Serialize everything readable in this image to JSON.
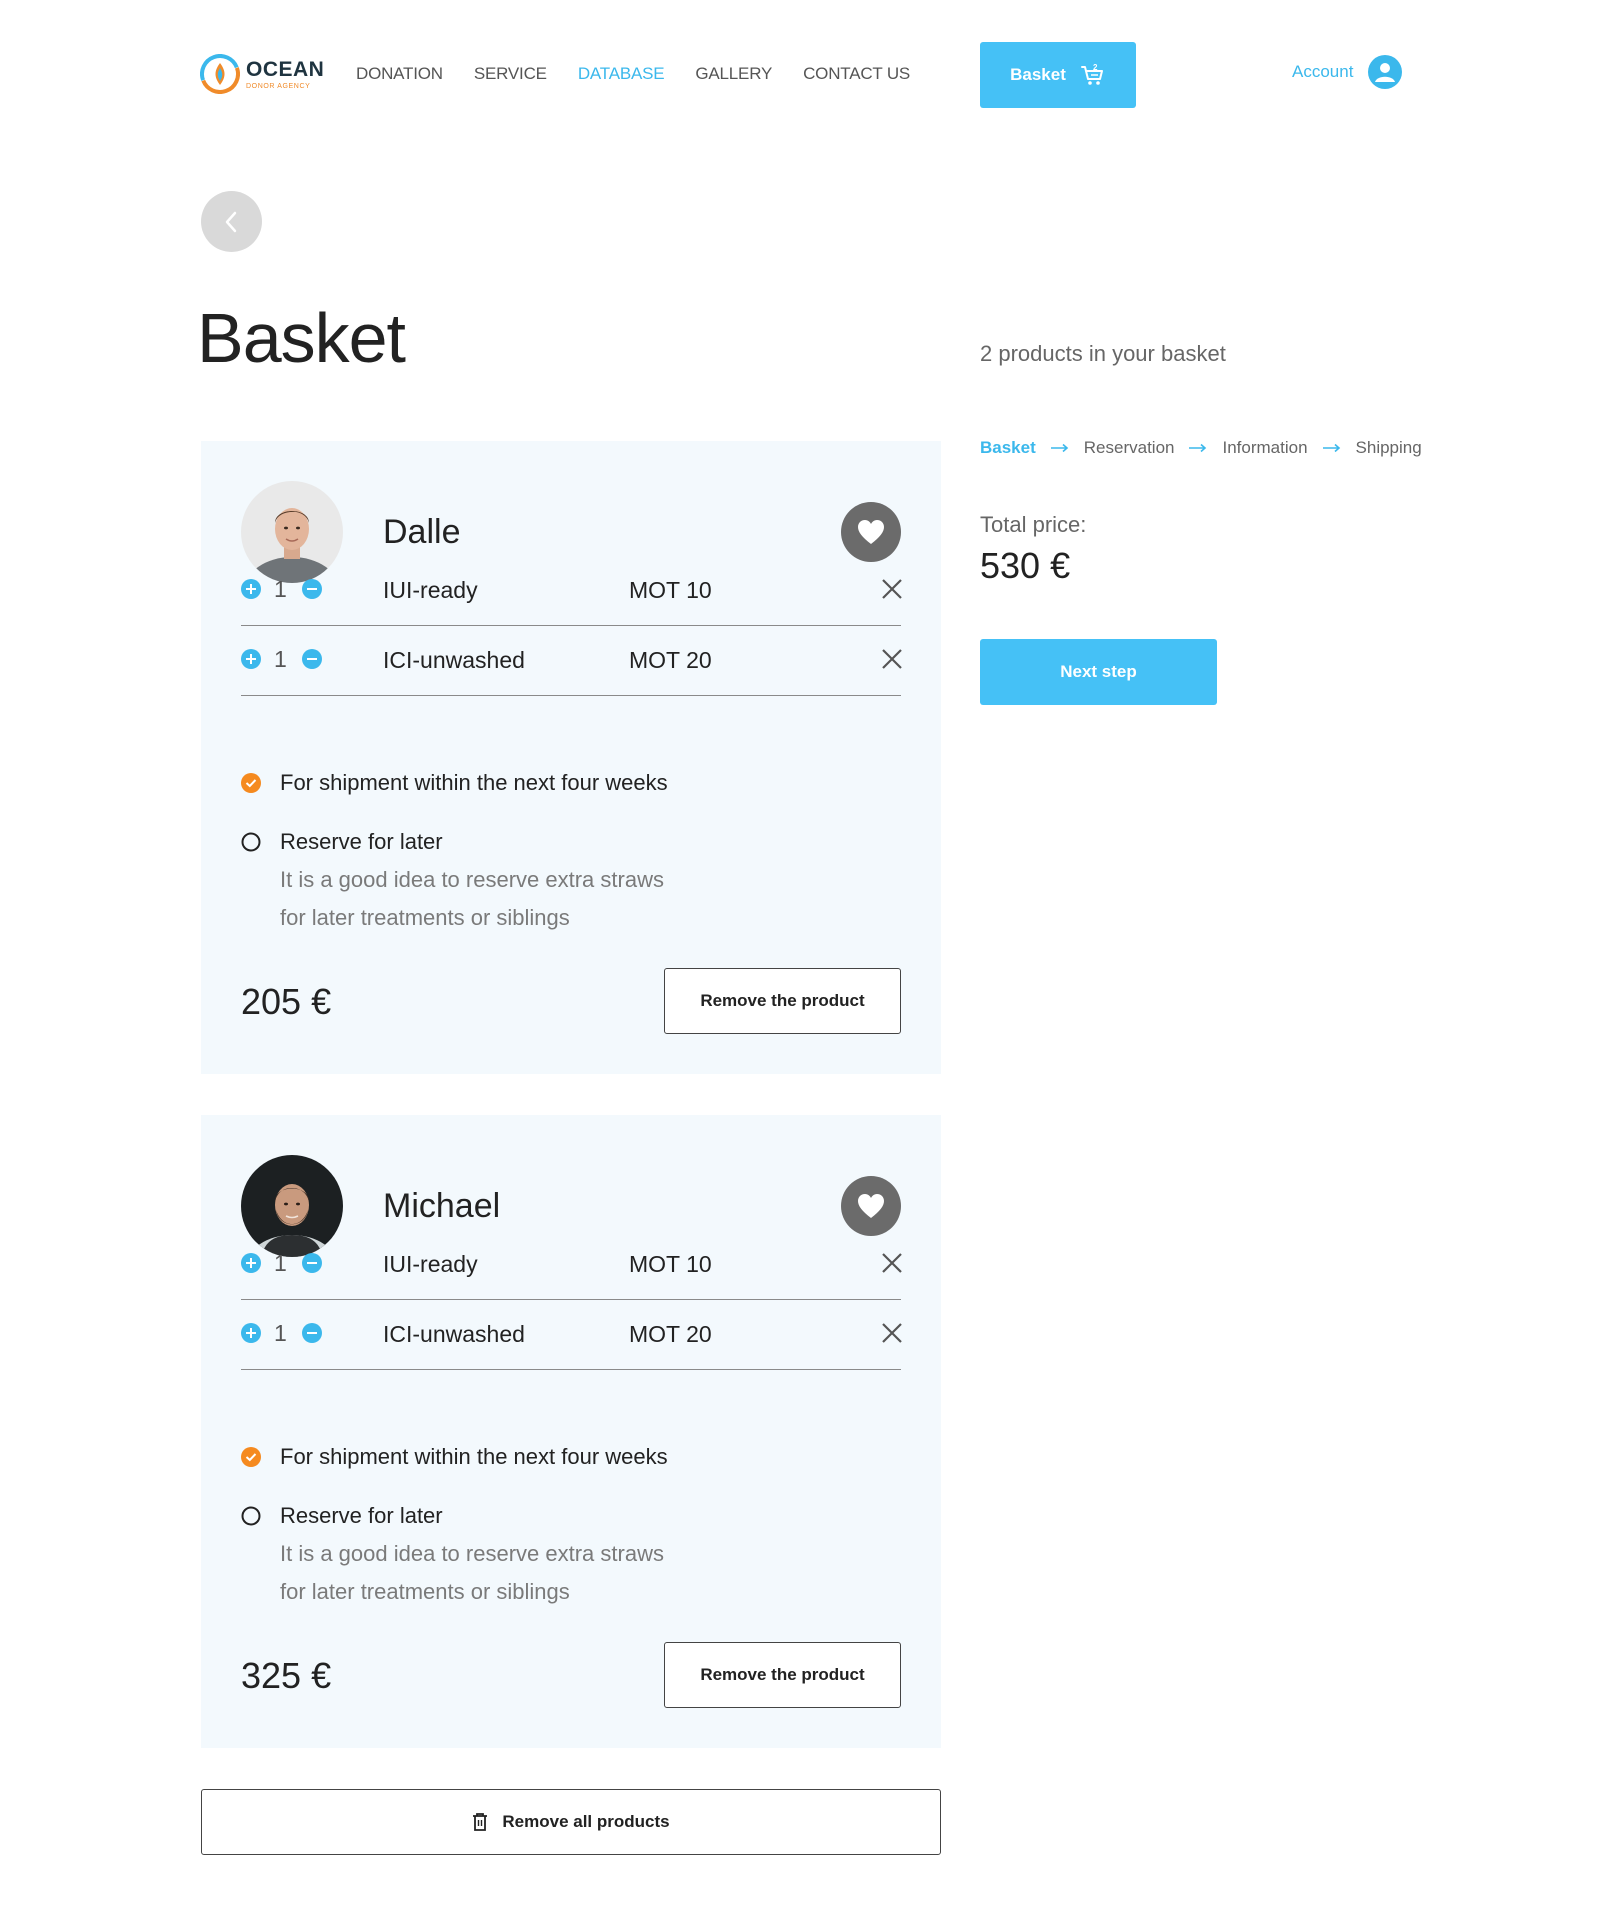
{
  "header": {
    "logo_name": "OCEAN",
    "logo_sub": "DONOR AGENCY",
    "nav": [
      {
        "label": "DONATION",
        "active": false
      },
      {
        "label": "SERVICE",
        "active": false
      },
      {
        "label": "DATABASE",
        "active": true
      },
      {
        "label": "GALLERY",
        "active": false
      },
      {
        "label": "CONTACT US",
        "active": false
      }
    ],
    "basket_label": "Basket",
    "basket_count": "2",
    "account_label": "Account"
  },
  "page": {
    "title": "Basket",
    "products_count": "2 products in your basket"
  },
  "steps": [
    {
      "label": "Basket",
      "current": true
    },
    {
      "label": "Reservation",
      "current": false
    },
    {
      "label": "Information",
      "current": false
    },
    {
      "label": "Shipping",
      "current": false
    }
  ],
  "summary": {
    "total_label": "Total price:",
    "total_value": "530 €",
    "next_label": "Next step"
  },
  "products": [
    {
      "name": "Dalle",
      "items": [
        {
          "qty": "1",
          "product": "IUI-ready",
          "mot": "MOT 10"
        },
        {
          "qty": "1",
          "product": "ICI-unwashed",
          "mot": "MOT 20"
        }
      ],
      "option_ship": "For shipment within the next four weeks",
      "option_reserve": "Reserve for later",
      "hint_line1": "It is a good idea to reserve extra straws",
      "hint_line2": "for later treatments or siblings",
      "selected_option": "ship",
      "price": "205 €",
      "remove_label": "Remove the product"
    },
    {
      "name": "Michael",
      "items": [
        {
          "qty": "1",
          "product": "IUI-ready",
          "mot": "MOT 10"
        },
        {
          "qty": "1",
          "product": "ICI-unwashed",
          "mot": "MOT 20"
        }
      ],
      "option_ship": "For shipment within the next four weeks",
      "option_reserve": "Reserve for later",
      "hint_line1": "It is a good idea to reserve extra straws",
      "hint_line2": "for later treatments or siblings",
      "selected_option": "ship",
      "price": "325 €",
      "remove_label": "Remove the product"
    }
  ],
  "remove_all_label": "Remove all products",
  "colors": {
    "accent": "#45c1f6",
    "link": "#3bb8ec",
    "card_bg": "#f3f9fd",
    "selected_radio": "#f58a1f",
    "fav_bg": "#6b6b6b"
  },
  "icons": [
    "cart-icon",
    "user-icon",
    "chevron-left-icon",
    "heart-icon",
    "plus-circle-icon",
    "minus-circle-icon",
    "close-icon",
    "check-circle-icon",
    "radio-empty-icon",
    "trash-icon",
    "arrow-right-icon"
  ]
}
